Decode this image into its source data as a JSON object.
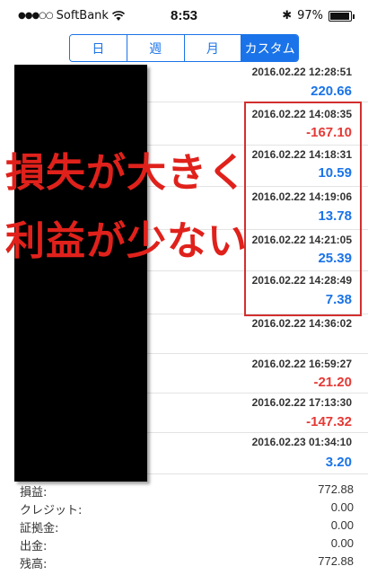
{
  "status_bar": {
    "carrier": "SoftBank",
    "signal": "●●●○○",
    "time": "8:53",
    "bluetooth": "✱",
    "battery_percent": "97%",
    "battery_level": 0.97
  },
  "segmented_control": {
    "tabs": [
      {
        "label": "日",
        "active": false
      },
      {
        "label": "週",
        "active": false
      },
      {
        "label": "月",
        "active": false
      },
      {
        "label": "カスタム",
        "active": true
      }
    ]
  },
  "trades": [
    {
      "date": "2016.02.22 12:28:51",
      "value": "220.66",
      "sign": "pos"
    },
    {
      "date": "2016.02.22 14:08:35",
      "value": "-167.10",
      "sign": "neg"
    },
    {
      "date": "2016.02.22 14:18:31",
      "value": "10.59",
      "sign": "pos"
    },
    {
      "date": "2016.02.22 14:19:06",
      "value": "13.78",
      "sign": "pos"
    },
    {
      "date": "2016.02.22 14:21:05",
      "value": "25.39",
      "sign": "pos"
    },
    {
      "date": "2016.02.22 14:28:49",
      "value": "7.38",
      "sign": "pos"
    },
    {
      "date": "2016.02.22 14:36:02",
      "value": "",
      "sign": "pos"
    },
    {
      "date": "2016.02.22 16:59:27",
      "value": "-21.20",
      "sign": "neg"
    },
    {
      "date": "2016.02.22 17:13:30",
      "value": "-147.32",
      "sign": "neg"
    },
    {
      "date": "2016.02.23 01:34:10",
      "value": "3.20",
      "sign": "pos"
    }
  ],
  "overlay": {
    "line1": "損失が大きく",
    "line2": "利益が少ない",
    "color": "#e0211b"
  },
  "summary": [
    {
      "label": "損益:",
      "value": "772.88"
    },
    {
      "label": "クレジット:",
      "value": "0.00"
    },
    {
      "label": "証拠金:",
      "value": "0.00"
    },
    {
      "label": "出金:",
      "value": "0.00"
    },
    {
      "label": "残高:",
      "value": "772.88"
    }
  ],
  "colors": {
    "accent": "#1a73e8",
    "positive": "#1a73e8",
    "negative": "#e53935",
    "highlight_border": "#d32f2f"
  }
}
